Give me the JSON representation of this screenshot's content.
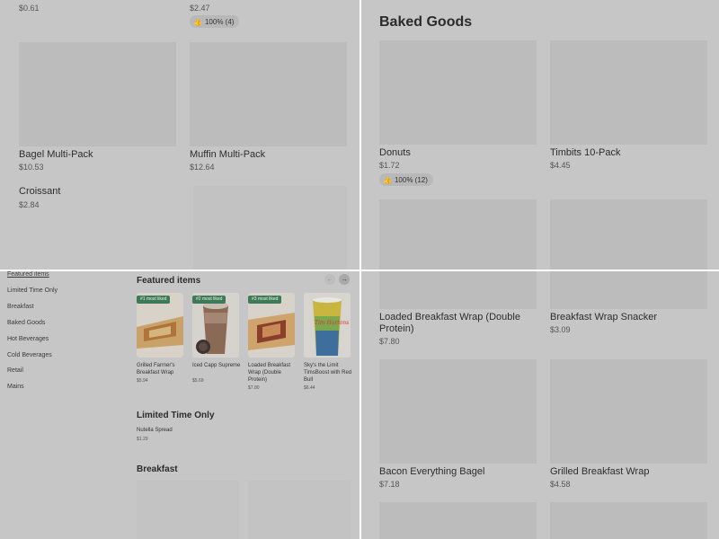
{
  "top_left": {
    "top_prices": [
      "$0.61",
      "$2.47"
    ],
    "top_like": "100% (4)",
    "items": [
      {
        "name": "Bagel Multi-Pack",
        "price": "$10.53"
      },
      {
        "name": "Muffin Multi-Pack",
        "price": "$12.64"
      },
      {
        "name": "Croissant",
        "price": "$2.84"
      }
    ]
  },
  "top_right": {
    "section_title": "Baked Goods",
    "items": [
      {
        "name": "Donuts",
        "price": "$1.72",
        "like": "100% (12)"
      },
      {
        "name": "Timbits 10-Pack",
        "price": "$4.45"
      }
    ]
  },
  "sidebar": {
    "items": [
      {
        "label": "Featured items"
      },
      {
        "label": "Limited Time Only"
      },
      {
        "label": "Breakfast"
      },
      {
        "label": "Baked Goods"
      },
      {
        "label": "Hot Beverages"
      },
      {
        "label": "Cold Beverages"
      },
      {
        "label": "Retail"
      },
      {
        "label": "Mains"
      }
    ]
  },
  "featured": {
    "title": "Featured items",
    "prev_arrow": "←",
    "next_arrow": "→",
    "cards": [
      {
        "badge": "#1 most liked",
        "name": "Grilled Farmer's Breakfast Wrap",
        "price": "$5.94"
      },
      {
        "badge": "#2 most liked",
        "name": "Iced Capp Supreme",
        "price": "$5.69"
      },
      {
        "badge": "#3 most liked",
        "name": "Loaded Breakfast Wrap (Double Protein)",
        "price": "$7.80"
      },
      {
        "badge": "",
        "name": "Sky's the Limit TimsBoost with Red Bull",
        "price": "$6.44"
      }
    ],
    "can_text": "Tim Hortons"
  },
  "limited": {
    "title": "Limited Time Only",
    "item_name": "Nutella Spread",
    "item_price": "$1.29"
  },
  "breakfast": {
    "title": "Breakfast"
  },
  "bottom_right": {
    "items": [
      {
        "name": "Loaded Breakfast Wrap (Double Protein)",
        "price": "$7.80"
      },
      {
        "name": "Breakfast Wrap Snacker",
        "price": "$3.09"
      },
      {
        "name": "Bacon Everything Bagel",
        "price": "$7.18"
      },
      {
        "name": "Grilled Breakfast Wrap",
        "price": "$4.58"
      }
    ]
  },
  "colors": {
    "overlay_gray": "#c6c6c6",
    "placeholder_gray": "#bcbcbc",
    "badge_green": "#3d7a55"
  },
  "icons": [
    "thumbs-up-icon",
    "arrow-left-icon",
    "arrow-right-icon"
  ]
}
